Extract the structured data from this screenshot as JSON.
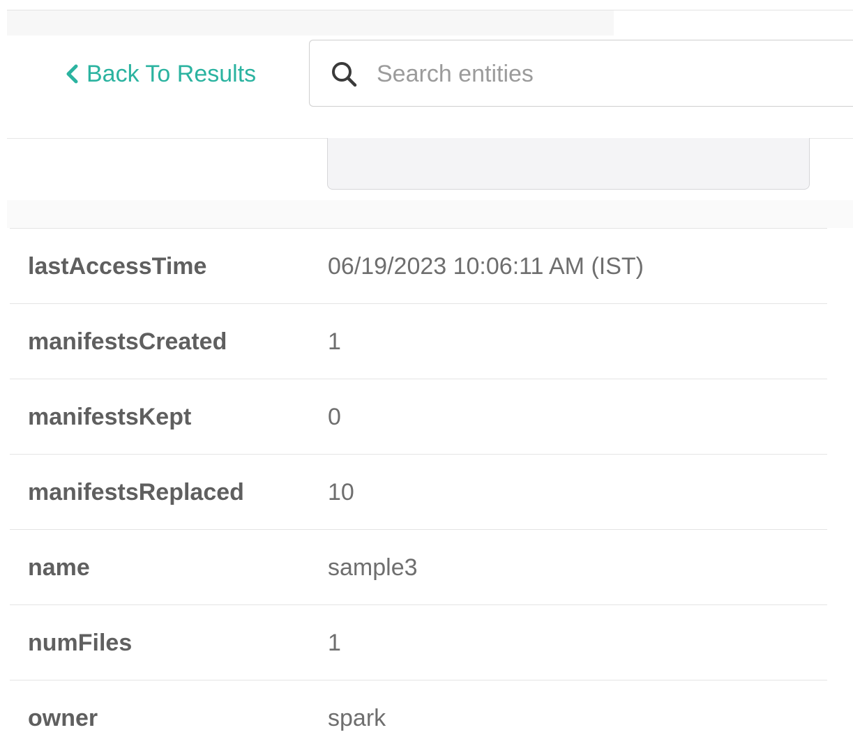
{
  "header": {
    "back_label": "Back To Results",
    "search_placeholder": "Search entities"
  },
  "properties": [
    {
      "key": "lastAccessTime",
      "value": "06/19/2023 10:06:11 AM (IST)"
    },
    {
      "key": "manifestsCreated",
      "value": "1"
    },
    {
      "key": "manifestsKept",
      "value": "0"
    },
    {
      "key": "manifestsReplaced",
      "value": "10"
    },
    {
      "key": "name",
      "value": "sample3"
    },
    {
      "key": "numFiles",
      "value": "1"
    },
    {
      "key": "owner",
      "value": "spark"
    }
  ],
  "colors": {
    "accent": "#2bb3a0",
    "key_text": "#5f5f5f",
    "value_text": "#6e6e6e",
    "divider": "#e4e4e4"
  },
  "icons": {
    "back": "chevron-left-icon",
    "search": "search-icon"
  }
}
